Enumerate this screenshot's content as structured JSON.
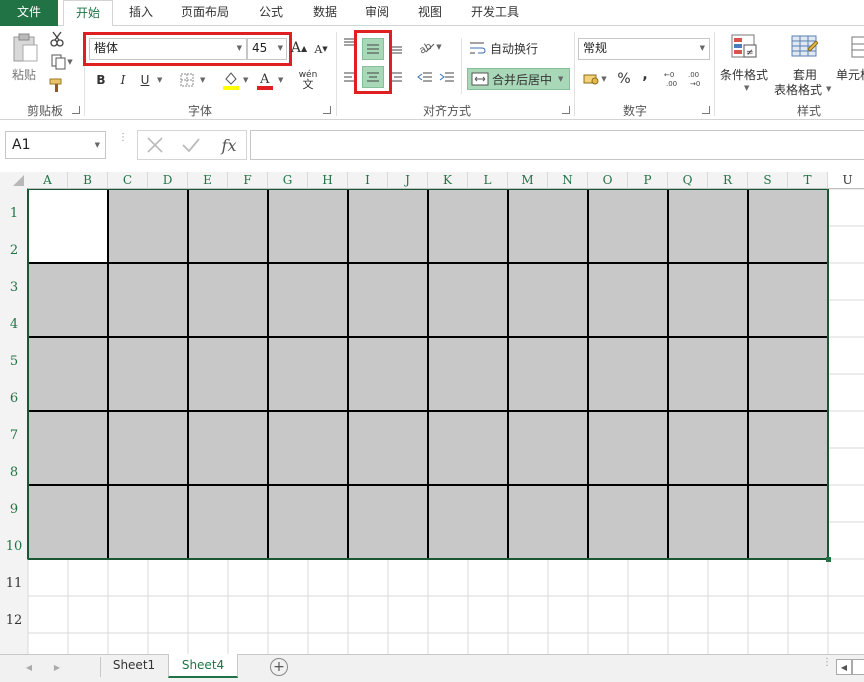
{
  "tabs": [
    {
      "label": "文件"
    },
    {
      "label": "开始"
    },
    {
      "label": "插入"
    },
    {
      "label": "页面布局"
    },
    {
      "label": "公式"
    },
    {
      "label": "数据"
    },
    {
      "label": "审阅"
    },
    {
      "label": "视图"
    },
    {
      "label": "开发工具"
    }
  ],
  "ribbon": {
    "clipboard": {
      "paste_label": "粘贴",
      "group_label": "剪贴板"
    },
    "font": {
      "font_name": "楷体",
      "font_size": "45",
      "group_label": "字体",
      "bold": "B",
      "italic": "I",
      "underline": "U",
      "phonetic": "wén"
    },
    "alignment": {
      "wrap_label": "自动换行",
      "merge_label": "合并后居中",
      "group_label": "对齐方式"
    },
    "number": {
      "format_value": "常规",
      "percent": "%",
      "comma": ",",
      "group_label": "数字"
    },
    "styles": {
      "conditional_label": "条件格式",
      "table_label_1": "套用",
      "table_label_2": "表格格式",
      "cell_label": "单元格",
      "group_label": "样式"
    }
  },
  "formula_bar": {
    "name_box": "A1",
    "fx": "fx",
    "formula": ""
  },
  "grid": {
    "columns": [
      "A",
      "B",
      "C",
      "D",
      "E",
      "F",
      "G",
      "H",
      "I",
      "J",
      "K",
      "L",
      "M",
      "N",
      "O",
      "P",
      "Q",
      "R",
      "S",
      "T",
      "U"
    ],
    "rows": [
      "1",
      "2",
      "3",
      "4",
      "5",
      "6",
      "7",
      "8",
      "9",
      "10",
      "11",
      "12"
    ],
    "selected_fill": "#c8c8c8",
    "header_accent": "#217346"
  },
  "sheets": [
    {
      "label": "Sheet1"
    },
    {
      "label": "Sheet4"
    }
  ],
  "colors": {
    "brand": "#217346",
    "highlight_box": "#e02020",
    "selected_button": "#a9d8b8"
  }
}
